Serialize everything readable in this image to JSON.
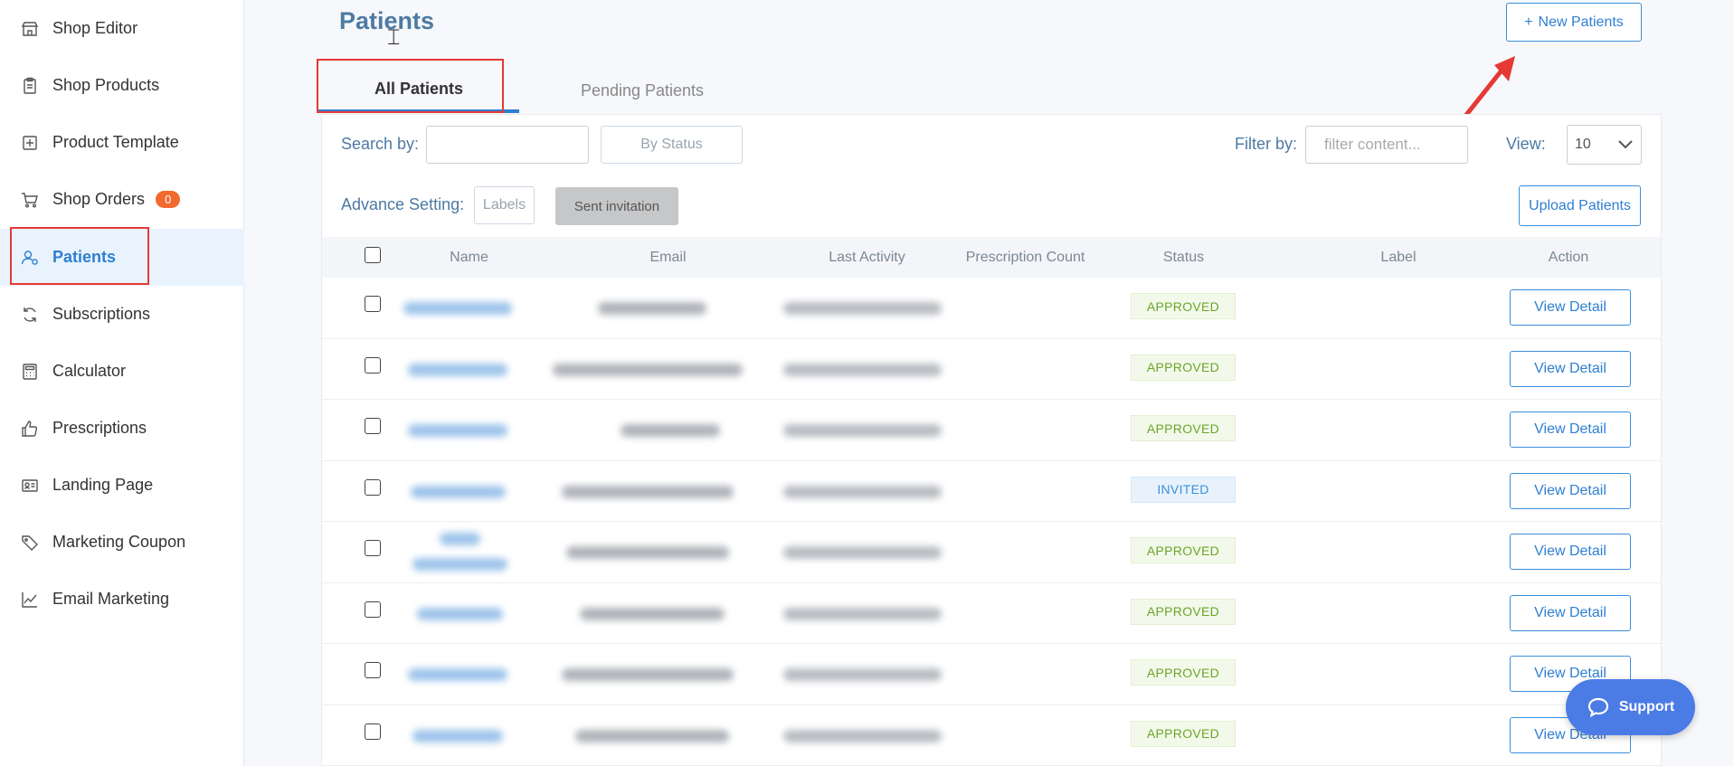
{
  "sidebar": {
    "items": [
      {
        "label": "Shop Editor",
        "icon": "store-icon"
      },
      {
        "label": "Shop Products",
        "icon": "clipboard-icon"
      },
      {
        "label": "Product Template",
        "icon": "template-icon"
      },
      {
        "label": "Shop Orders",
        "icon": "cart-icon",
        "badge": "0"
      },
      {
        "label": "Patients",
        "icon": "user-icon"
      },
      {
        "label": "Subscriptions",
        "icon": "refresh-icon"
      },
      {
        "label": "Calculator",
        "icon": "calculator-icon"
      },
      {
        "label": "Prescriptions",
        "icon": "thumbs-up-icon"
      },
      {
        "label": "Landing Page",
        "icon": "id-card-icon"
      },
      {
        "label": "Marketing Coupon",
        "icon": "tag-icon"
      },
      {
        "label": "Email Marketing",
        "icon": "chart-line-icon"
      }
    ]
  },
  "page": {
    "title": "Patients",
    "new_button": "New Patients",
    "new_button_icon": "+"
  },
  "tabs": [
    "All Patients",
    "Pending Patients"
  ],
  "toolbar": {
    "search_label": "Search by:",
    "search_value": "",
    "by_status": "By Status",
    "filter_label": "Filter by:",
    "filter_placeholder": "filter content...",
    "view_label": "View:",
    "view_value": "10",
    "advance_label": "Advance Setting:",
    "labels_button": "Labels",
    "sent_invitation": "Sent invitation",
    "upload_button": "Upload Patients"
  },
  "table": {
    "columns": [
      "Name",
      "Email",
      "Last Activity",
      "Prescription Count",
      "Status",
      "Label",
      "Action"
    ],
    "rows": [
      {
        "status": "APPROVED",
        "action": "View Detail"
      },
      {
        "status": "APPROVED",
        "action": "View Detail"
      },
      {
        "status": "APPROVED",
        "action": "View Detail"
      },
      {
        "status": "INVITED",
        "action": "View Detail"
      },
      {
        "status": "APPROVED",
        "action": "View Detail"
      },
      {
        "status": "APPROVED",
        "action": "View Detail"
      },
      {
        "status": "APPROVED",
        "action": "View Detail"
      },
      {
        "status": "APPROVED",
        "action": "View Detail"
      }
    ]
  },
  "support": {
    "label": "Support"
  },
  "colors": {
    "accent": "#2f7fd1",
    "title": "#4e7aa3",
    "badge": "#f26a2e",
    "approved": "#6aa52a",
    "invited": "#3b8fd9",
    "highlight": "#e53935",
    "support": "#4b7be5"
  }
}
